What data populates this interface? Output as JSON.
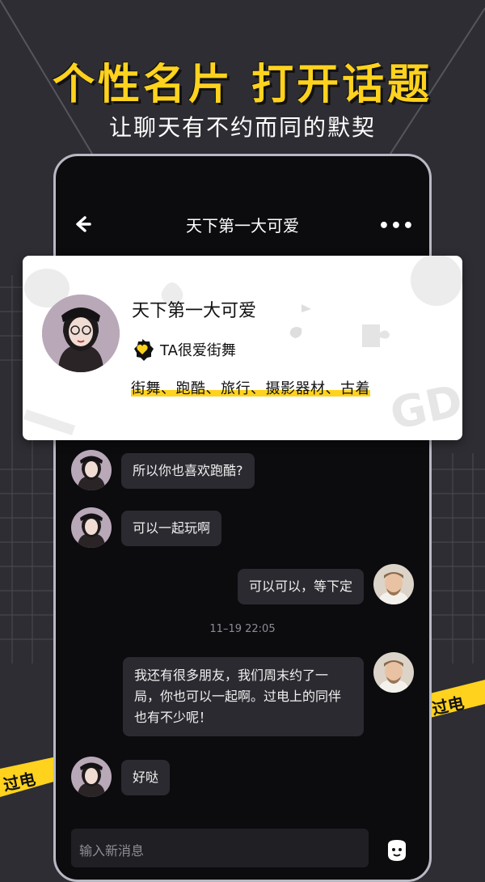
{
  "hero": {
    "title": "个性名片  打开话题",
    "subtitle": "让聊天有不约而同的默契"
  },
  "nav": {
    "title": "天下第一大可爱",
    "more": "•••"
  },
  "profile_card": {
    "name": "天下第一大可爱",
    "badge_text": "TA很爱街舞",
    "tags": "街舞、跑酷、旅行、摄影器材、古着"
  },
  "messages": [
    {
      "side": "left",
      "text": "所以你也喜欢跑酷?"
    },
    {
      "side": "left",
      "text": "可以一起玩啊"
    },
    {
      "side": "right",
      "text": "可以可以，等下定"
    },
    {
      "side": "right",
      "text": "我还有很多朋友，我们周末约了一局，你也可以一起啊。过电上的同伴也有不少呢！"
    },
    {
      "side": "left",
      "text": "好哒"
    }
  ],
  "timestamp": "11–19 22:05",
  "input": {
    "placeholder": "输入新消息"
  },
  "tape_text": "过电",
  "colors": {
    "accent": "#ffd21e",
    "background": "#2d2d33",
    "phone": "#0c0c0f",
    "bubble": "#2a2a30"
  }
}
